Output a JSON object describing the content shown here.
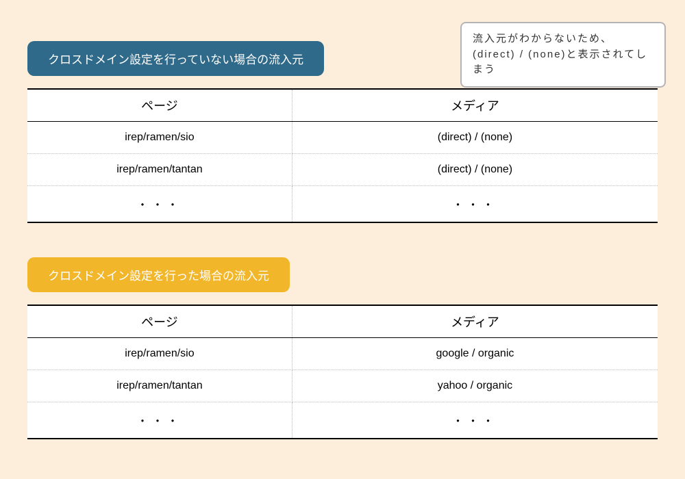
{
  "callout": {
    "text": "流入元がわからないため、(direct) / (none)と表示されてしまう"
  },
  "section1": {
    "title": "クロスドメイン設定を行っていない場合の流入元",
    "headers": {
      "page": "ページ",
      "media": "メディア"
    },
    "rows": [
      {
        "page": "irep/ramen/sio",
        "media": "(direct) / (none)"
      },
      {
        "page": "irep/ramen/tantan",
        "media": "(direct) / (none)"
      },
      {
        "page": "・・・",
        "media": "・・・"
      }
    ]
  },
  "section2": {
    "title": "クロスドメイン設定を行った場合の流入元",
    "headers": {
      "page": "ページ",
      "media": "メディア"
    },
    "rows": [
      {
        "page": "irep/ramen/sio",
        "media": "google / organic"
      },
      {
        "page": "irep/ramen/tantan",
        "media": "yahoo / organic"
      },
      {
        "page": "・・・",
        "media": "・・・"
      }
    ]
  }
}
